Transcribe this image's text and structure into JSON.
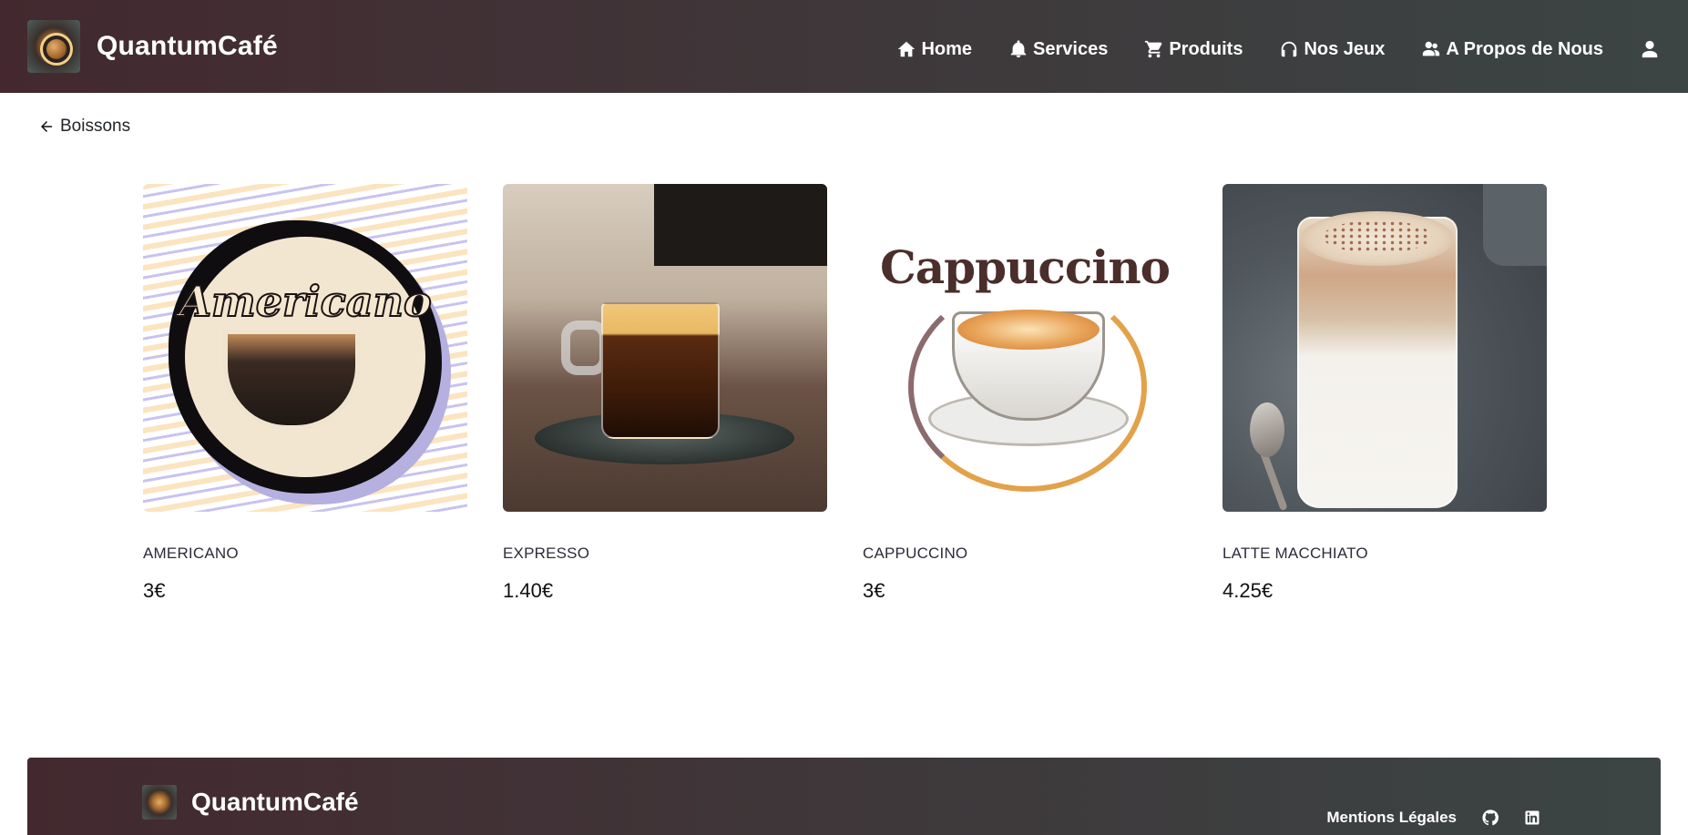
{
  "header": {
    "brand_name": "QuantumCafé",
    "nav": [
      {
        "label": "Home",
        "icon": "home-icon"
      },
      {
        "label": "Services",
        "icon": "bell-icon"
      },
      {
        "label": "Produits",
        "icon": "cart-icon"
      },
      {
        "label": "Nos Jeux",
        "icon": "headphones-icon"
      },
      {
        "label": "A Propos de Nous",
        "icon": "users-icon"
      }
    ],
    "user_icon": "user-icon"
  },
  "back_link": {
    "label": "Boissons",
    "icon": "arrow-left-icon"
  },
  "products": [
    {
      "name": "AMERICANO",
      "price": "3€",
      "image_text": "Americano"
    },
    {
      "name": "EXPRESSO",
      "price": "1.40€"
    },
    {
      "name": "CAPPUCCINO",
      "price": "3€",
      "image_text": "Cappuccino"
    },
    {
      "name": "LATTE MACCHIATO",
      "price": "4.25€"
    }
  ],
  "footer": {
    "brand_name": "QuantumCafé",
    "legal_label": "Mentions Légales",
    "icons": [
      "github-icon",
      "linkedin-icon"
    ]
  },
  "colors": {
    "header_gradient_start": "#43292f",
    "header_gradient_end": "#3c4544",
    "text_primary": "#212529",
    "background": "#ffffff"
  }
}
